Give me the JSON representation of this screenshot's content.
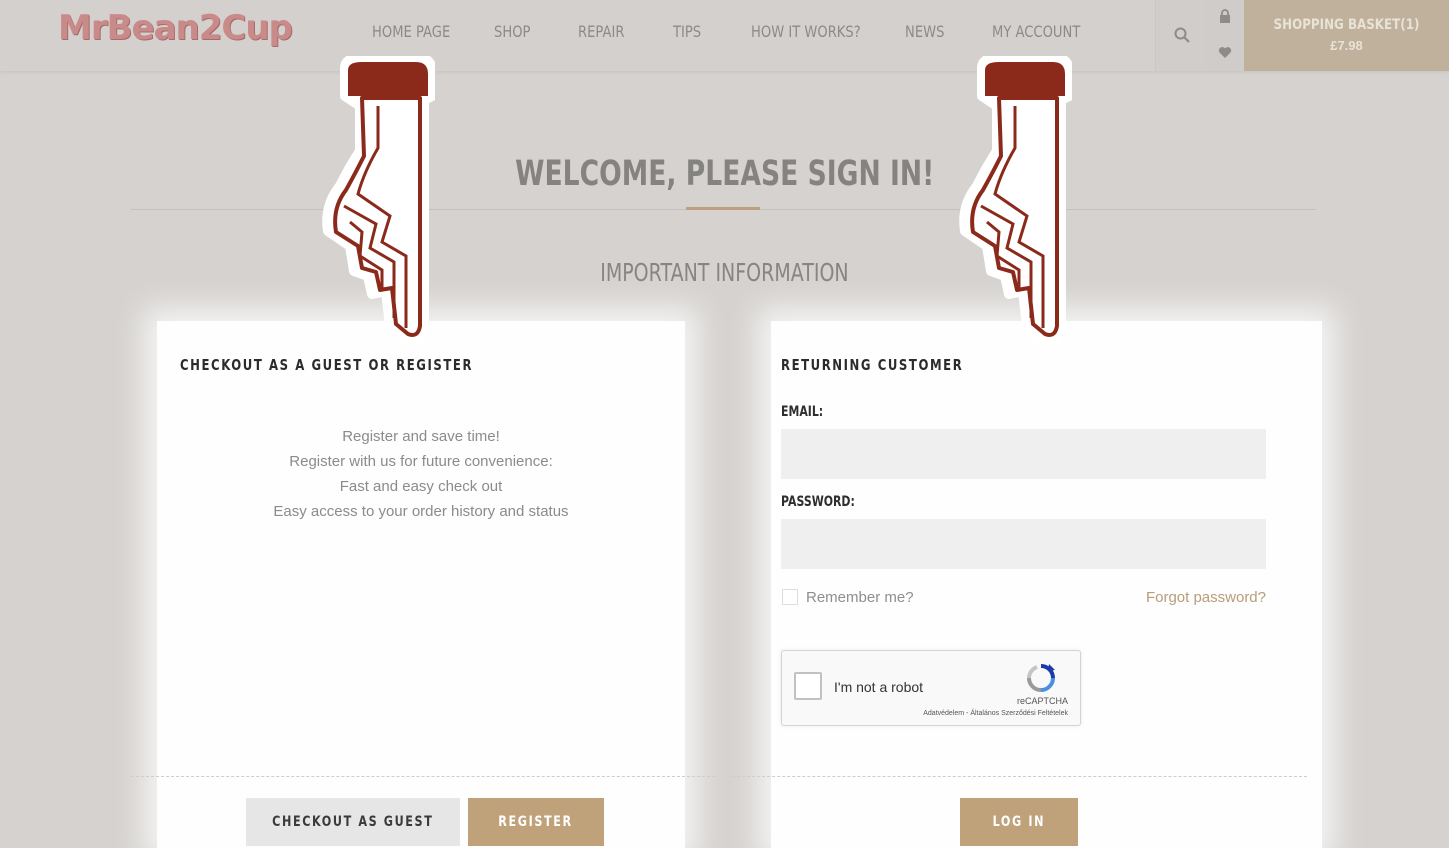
{
  "brand": {
    "logo_text": "MrBean2Cup"
  },
  "nav": {
    "items": [
      {
        "label": "HOME PAGE"
      },
      {
        "label": "SHOP"
      },
      {
        "label": "REPAIR"
      },
      {
        "label": "TIPS"
      },
      {
        "label": "HOW IT WORKS?"
      },
      {
        "label": "NEWS"
      },
      {
        "label": "MY ACCOUNT"
      }
    ]
  },
  "header_icons": [
    "search-icon",
    "lock-icon",
    "heart-icon"
  ],
  "basket": {
    "label": "SHOPPING BASKET(1)",
    "total": "£7.98"
  },
  "page": {
    "title": "WELCOME, PLEASE SIGN IN!",
    "subtitle": "IMPORTANT INFORMATION"
  },
  "guest_panel": {
    "title": "CHECKOUT AS A GUEST OR REGISTER",
    "benefits": [
      "Register and save time!",
      "Register with us for future convenience:",
      "Fast and easy check out",
      "Easy access to your order history and status"
    ],
    "guest_button": "CHECKOUT AS GUEST",
    "register_button": "REGISTER"
  },
  "login_panel": {
    "title": "RETURNING CUSTOMER",
    "email_label": "EMAIL:",
    "email_value": "",
    "password_label": "PASSWORD:",
    "password_value": "",
    "remember_label": "Remember me?",
    "forgot_label": "Forgot password?",
    "login_button": "LOG IN"
  },
  "captcha": {
    "text": "I'm not a robot",
    "brand": "reCAPTCHA",
    "links": "Adatvédelem - Általános Szerződési Feltételek"
  },
  "colors": {
    "accent": "#c0a27a",
    "pointer_fill": "#8b2a1a",
    "basket_bg": "#bfb19b"
  }
}
